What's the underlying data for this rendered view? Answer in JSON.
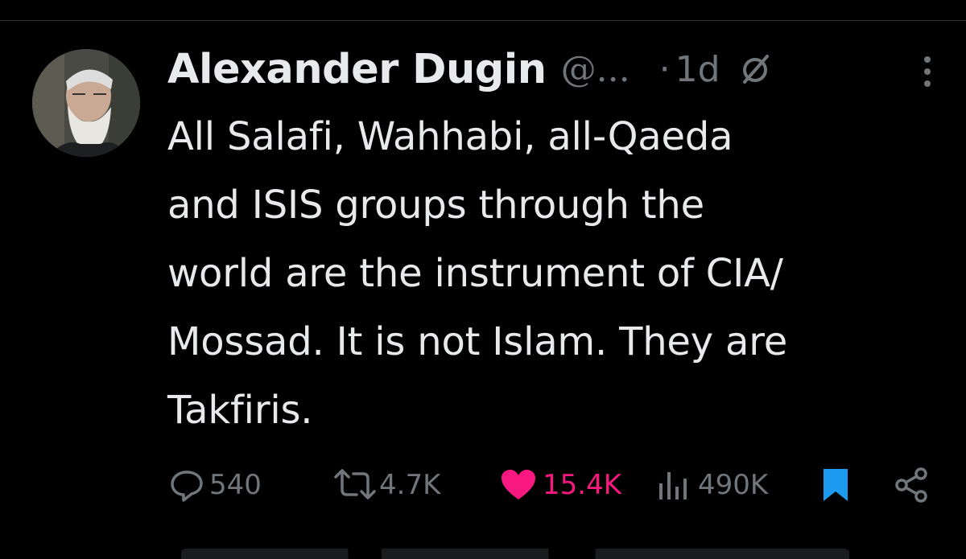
{
  "author": {
    "name": "Alexander Dugin",
    "handle": "@...",
    "separator": "·",
    "time": "1d"
  },
  "tweet": {
    "lines": [
      "All Salafi, Wahhabi, all-Qaeda",
      "and ISIS groups through the",
      "world are the instrument of CIA/",
      "Mossad. It is not Islam. They are",
      "Takfiris."
    ]
  },
  "metrics": {
    "replies": "540",
    "reposts": "4.7K",
    "likes": "15.4K",
    "views": "490K"
  },
  "icons": {
    "reply": "reply-icon",
    "repost": "repost-icon",
    "like": "heart-icon",
    "views": "views-icon",
    "bookmark": "bookmark-icon",
    "share": "share-icon",
    "more": "more-icon",
    "grok": "slash-circle-icon"
  },
  "colors": {
    "background": "#000000",
    "text": "#e7e9ea",
    "muted": "#71767b",
    "like": "#f91880",
    "bookmark": "#1d9bf0"
  }
}
